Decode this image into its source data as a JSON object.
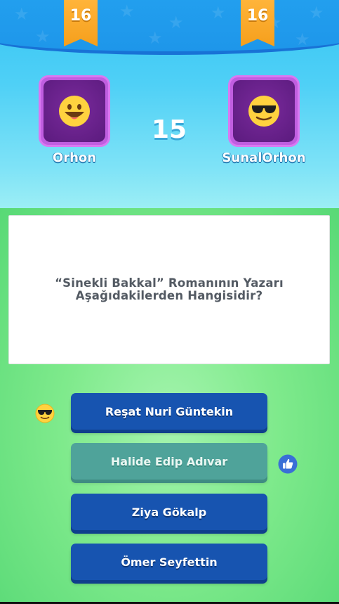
{
  "header": {
    "left_level": "16",
    "right_level": "16"
  },
  "players": {
    "left": {
      "name": "Orhon",
      "avatar_icon": "grinning-face-icon"
    },
    "right": {
      "name": "SunalOrhon",
      "avatar_icon": "sunglasses-face-icon"
    }
  },
  "round": {
    "number": "15"
  },
  "question": {
    "text": "“Sinekli Bakkal” Romanının Yazarı\nAşağıdakilerden Hangisidir?"
  },
  "answers": [
    {
      "label": "Reşat Nuri Güntekin",
      "state": "active",
      "reaction": "sunglasses-face-icon"
    },
    {
      "label": "Halide Edip Adıvar",
      "state": "faded",
      "reaction": "thumbs-up-icon"
    },
    {
      "label": "Ziya Gökalp",
      "state": "active"
    },
    {
      "label": "Ömer Seyfettin",
      "state": "active"
    }
  ],
  "colors": {
    "answer_blue": "#1754b0",
    "answer_faded": "#4fa39a",
    "ribbon_orange": "#f7a521",
    "avatar_purple": "#c05ee0",
    "top_bg": "#36c4f4",
    "bottom_bg": "#7fea8c"
  }
}
